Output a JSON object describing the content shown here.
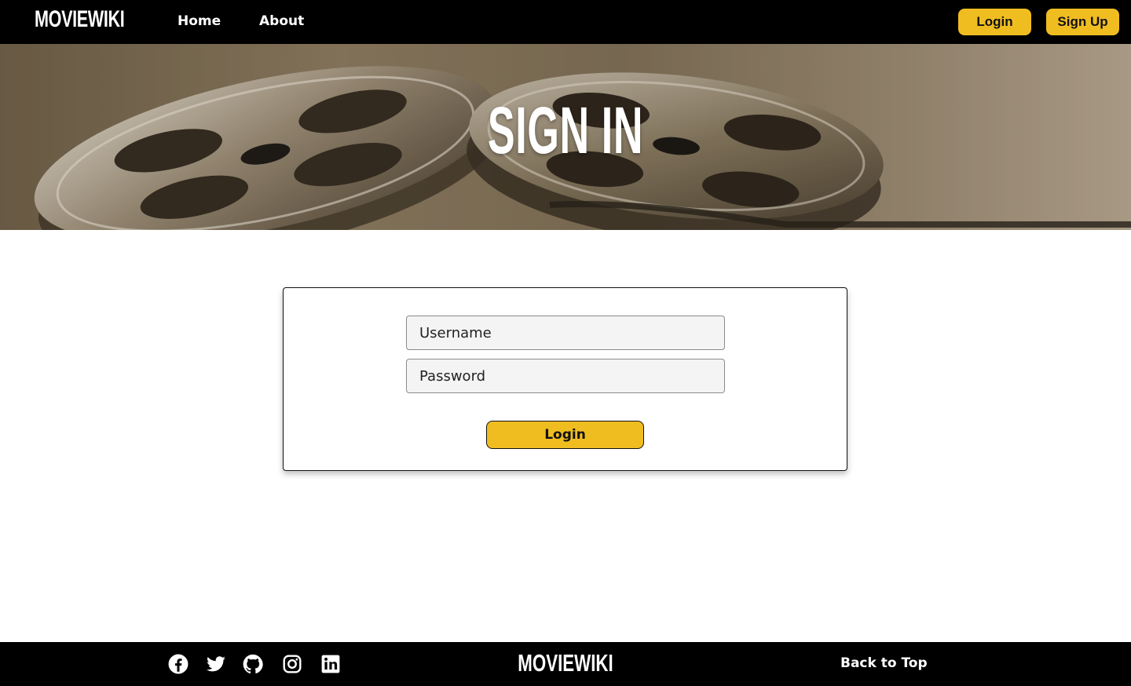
{
  "navbar": {
    "brand": "MOVIEWIKI",
    "links": [
      {
        "label": "Home"
      },
      {
        "label": "About"
      }
    ],
    "login_label": "Login",
    "signup_label": "Sign Up"
  },
  "hero": {
    "title": "SIGN IN"
  },
  "form": {
    "username_placeholder": "Username",
    "password_placeholder": "Password",
    "submit_label": "Login"
  },
  "footer": {
    "brand": "MOVIEWIKI",
    "back_to_top": "Back to Top",
    "social_icons": [
      "facebook-icon",
      "twitter-icon",
      "github-icon",
      "instagram-icon",
      "linkedin-icon"
    ]
  },
  "colors": {
    "accent": "#f0bd21",
    "nav_background": "#000000",
    "footer_background": "#000000"
  }
}
